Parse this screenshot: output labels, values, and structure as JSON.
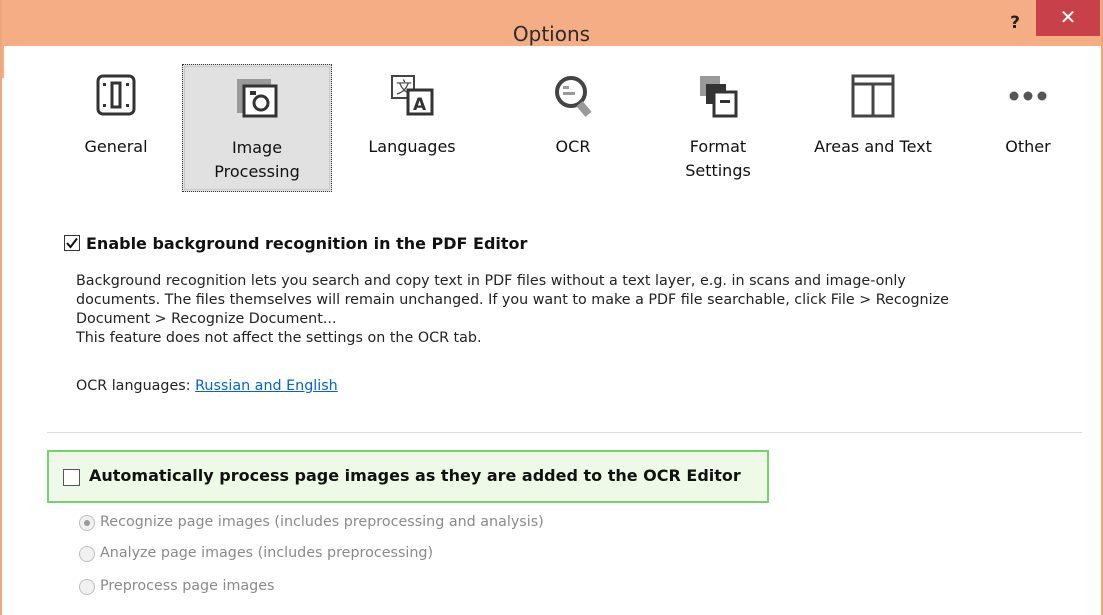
{
  "window": {
    "title": "Options",
    "help_label": "?",
    "close_label": "✕",
    "accent_color": "#f4ad84",
    "close_color": "#c8414a"
  },
  "tabs": [
    {
      "label": "General",
      "icon": "general-icon",
      "selected": false
    },
    {
      "label": "Image\nProcessing",
      "icon": "image-processing-icon",
      "selected": true
    },
    {
      "label": "Languages",
      "icon": "languages-icon",
      "selected": false
    },
    {
      "label": "OCR",
      "icon": "ocr-icon",
      "selected": false
    },
    {
      "label": "Format\nSettings",
      "icon": "format-settings-icon",
      "selected": false
    },
    {
      "label": "Areas and Text",
      "icon": "areas-and-text-icon",
      "selected": false
    },
    {
      "label": "Other",
      "icon": "more-icon",
      "selected": false
    }
  ],
  "background_recognition": {
    "checked": true,
    "label": "Enable background recognition in the PDF Editor",
    "desc_line1": "Background recognition lets you search and copy text in PDF files without a text layer, e.g. in scans and image-only",
    "desc_line2": "documents. The files themselves will remain unchanged. If you want to make a PDF file searchable, click File > Recognize",
    "desc_line3": "Document > Recognize Document...",
    "desc_line4": "This feature does not affect the settings on the OCR tab.",
    "languages_prefix": "OCR languages: ",
    "languages_link": "Russian and English"
  },
  "auto_process": {
    "checked": false,
    "label": "Automatically process page images as they are added to the OCR Editor",
    "highlight_color": "#76d26c",
    "options": [
      {
        "label": "Recognize page images (includes preprocessing and analysis)",
        "selected": true
      },
      {
        "label": "Analyze page images (includes preprocessing)",
        "selected": false
      },
      {
        "label": "Preprocess page images",
        "selected": false
      }
    ]
  }
}
